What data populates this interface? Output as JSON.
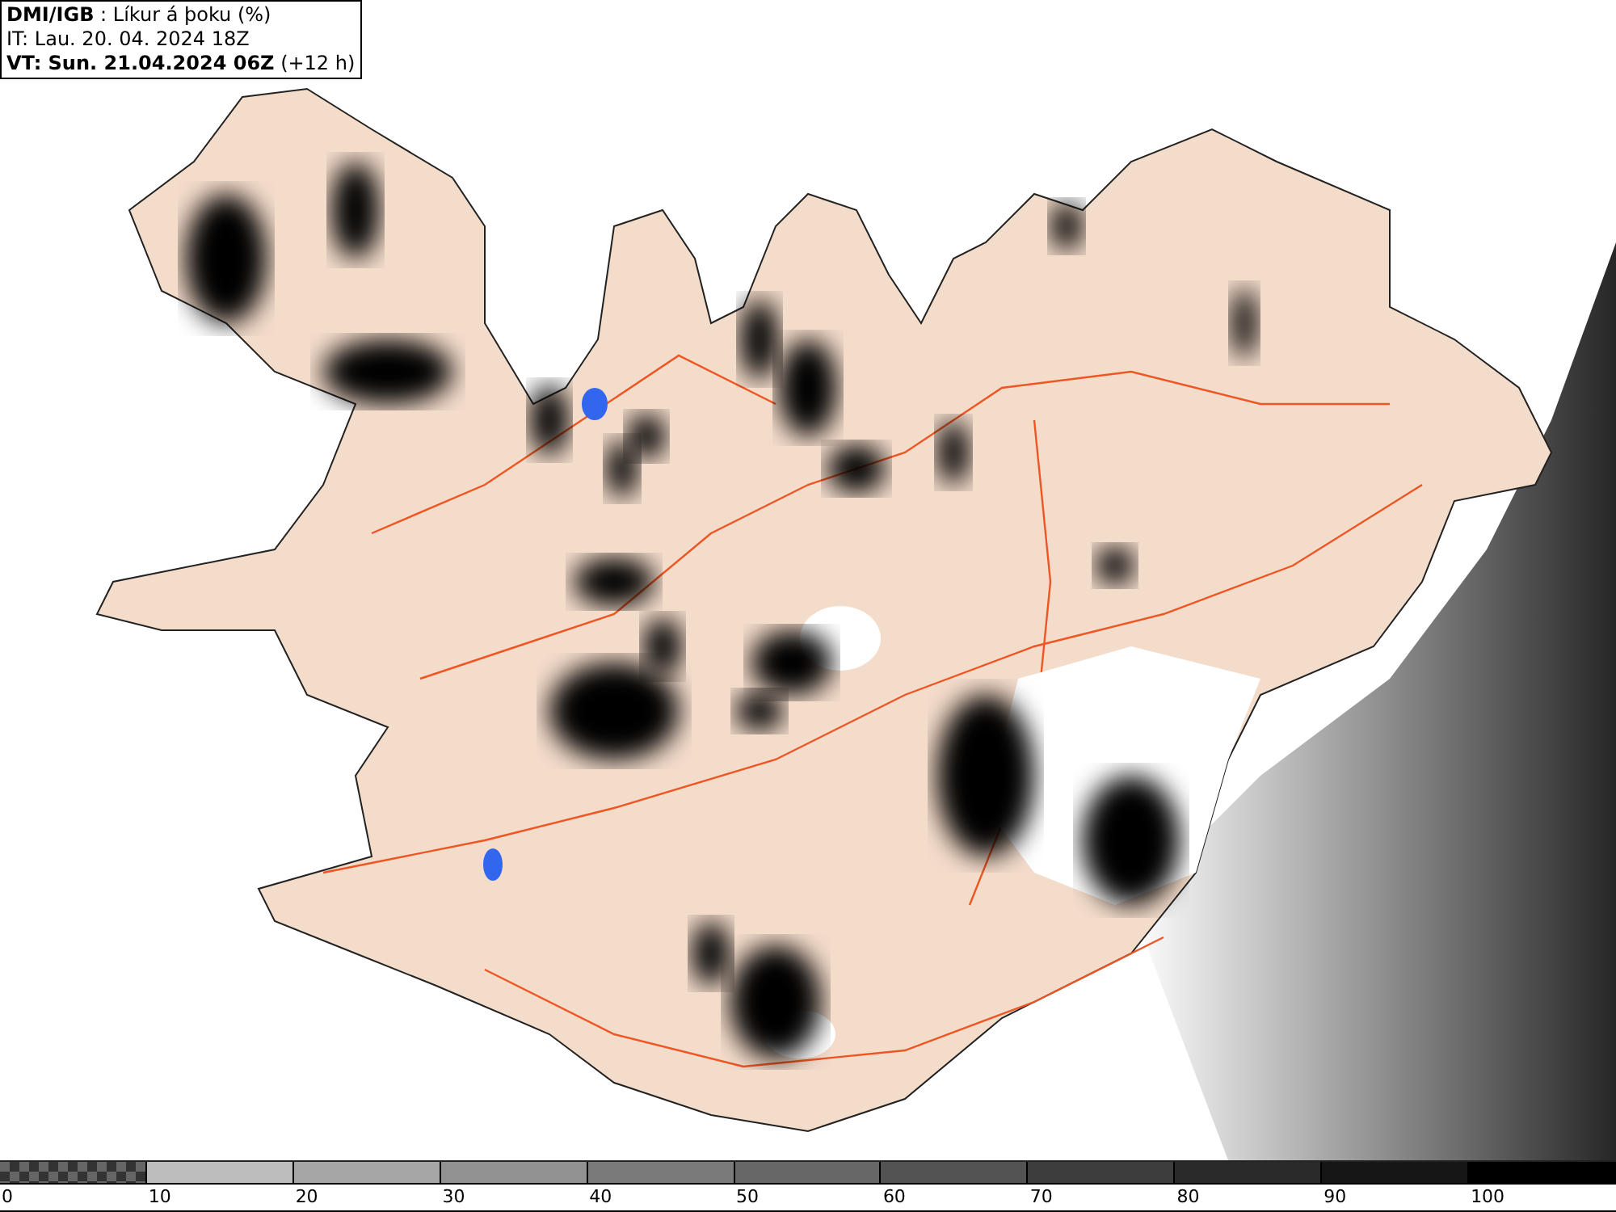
{
  "header": {
    "lines": [
      "**DMI/IGB** : Líkur á þoku (%)",
      "IT: Lau. 20. 04. 2024 18Z",
      "**VT: Sun. 21.04.2024 06Z** (+12 h)"
    ]
  },
  "legend": {
    "segments": [
      {
        "kind": "checker",
        "color": "#666666"
      },
      {
        "kind": "solid",
        "color": "#bdbdbd"
      },
      {
        "kind": "solid",
        "color": "#a6a6a6"
      },
      {
        "kind": "solid",
        "color": "#929292"
      },
      {
        "kind": "solid",
        "color": "#7a7a7a"
      },
      {
        "kind": "solid",
        "color": "#676767"
      },
      {
        "kind": "solid",
        "color": "#535353"
      },
      {
        "kind": "solid",
        "color": "#3d3d3d"
      },
      {
        "kind": "solid",
        "color": "#2a2a2a"
      },
      {
        "kind": "solid",
        "color": "#161616"
      },
      {
        "kind": "solid",
        "color": "#000000"
      }
    ],
    "labels": [
      "0",
      "10",
      "20",
      "30",
      "40",
      "50",
      "60",
      "70",
      "80",
      "90",
      "100"
    ]
  }
}
